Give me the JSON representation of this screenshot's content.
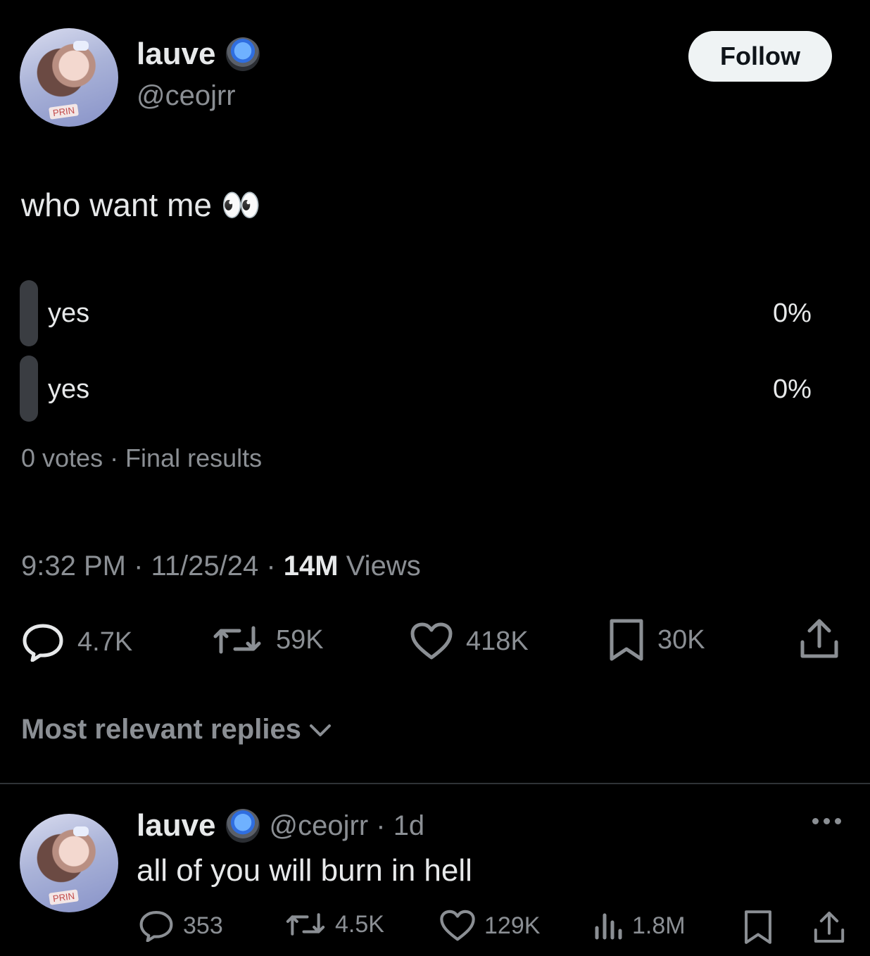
{
  "tweet": {
    "author_name": "lauve",
    "author_handle": "@ceojrr",
    "follow_label": "Follow",
    "text": "who want me 👀",
    "poll": {
      "options": [
        {
          "label": "yes",
          "percent": "0%"
        },
        {
          "label": "yes",
          "percent": "0%"
        }
      ],
      "summary": "0 votes · Final results"
    },
    "time": "9:32 PM · 11/25/24 · ",
    "views_count": "14M",
    "views_label": " Views",
    "stats": {
      "replies": "4.7K",
      "retweets": "59K",
      "likes": "418K",
      "bookmarks": "30K"
    }
  },
  "replies_section": {
    "sort_label": "Most relevant replies"
  },
  "reply": {
    "author_name": "lauve",
    "handle_time": "@ceojrr · 1d",
    "text": "all of you will burn in hell",
    "stats": {
      "replies": "353",
      "retweets": "4.5K",
      "likes": "129K",
      "views": "1.8M"
    }
  },
  "icons": {
    "avatar_tag": "PRIN"
  },
  "colors": {
    "background": "#000000",
    "text_primary": "#e7e9ea",
    "text_secondary": "#8b8f94",
    "poll_bar": "#3a3d42"
  }
}
